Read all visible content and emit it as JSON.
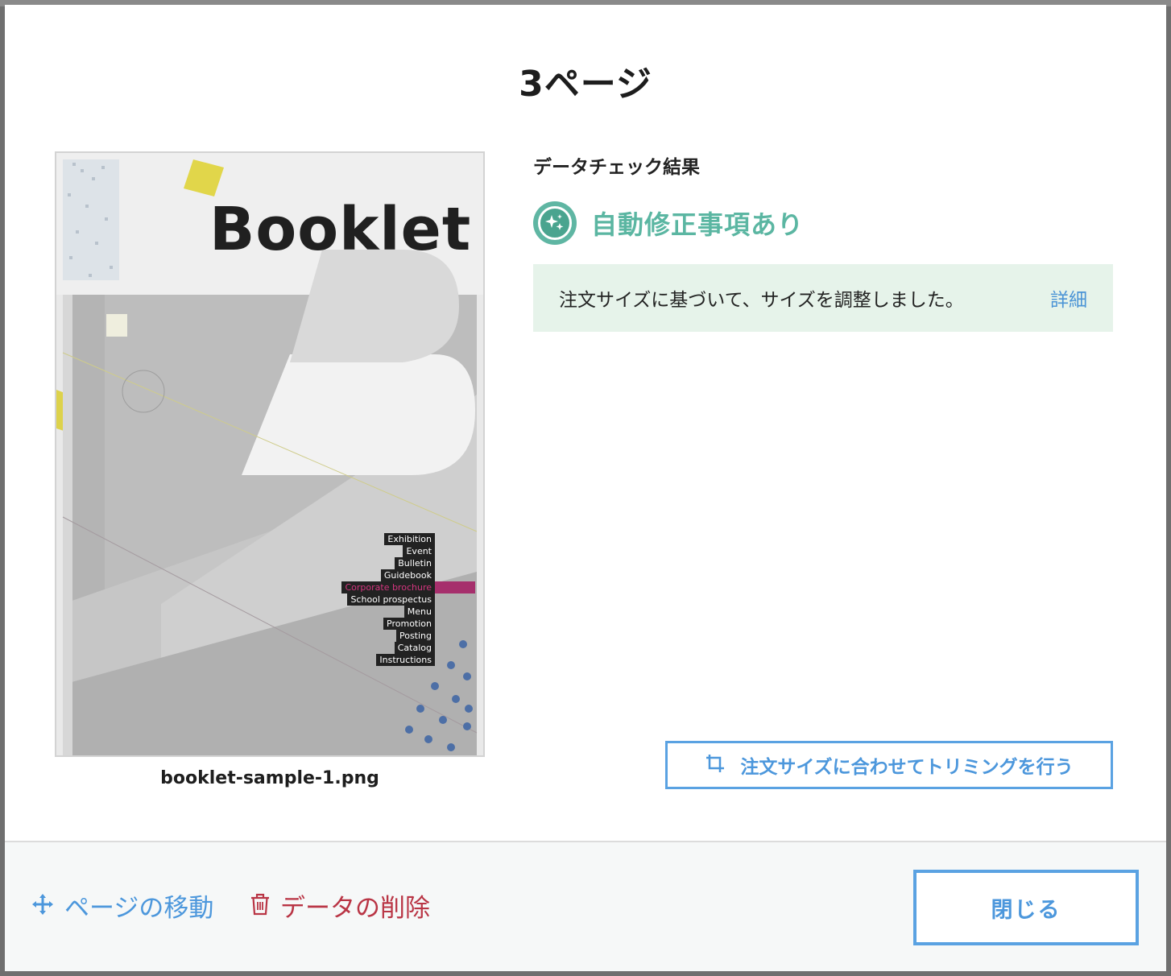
{
  "dialog": {
    "title": "3ページ"
  },
  "preview": {
    "cover_title": "Booklet",
    "cover_menu": [
      "Exhibition",
      "Event",
      "Bulletin",
      "Guidebook",
      "Corporate brochure",
      "School prospectus",
      "Menu",
      "Promotion",
      "Posting",
      "Catalog",
      "Instructions"
    ],
    "file_name": "booklet-sample-1.png"
  },
  "check": {
    "section_label": "データチェック結果",
    "status_icon": "sparkle-icon",
    "status_text": "自動修正事項あり",
    "notice_text": "注文サイズに基づいて、サイズを調整しました。",
    "detail_link": "詳細",
    "trim_icon": "crop-icon",
    "trim_button": "注文サイズに合わせてトリミングを行う"
  },
  "footer": {
    "move_icon": "move-arrows-icon",
    "move_label": "ページの移動",
    "delete_icon": "trash-icon",
    "delete_label": "データの削除",
    "close_label": "閉じる"
  },
  "colors": {
    "accent_blue": "#4c97dc",
    "status_green": "#5bb6a2",
    "notice_bg": "#e6f3ea",
    "danger_red": "#b93545"
  }
}
